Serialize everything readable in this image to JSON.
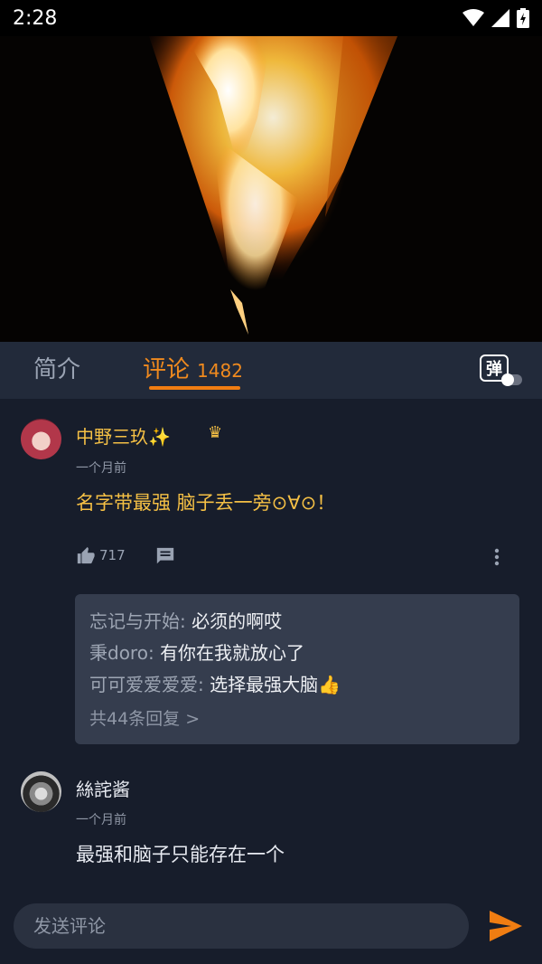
{
  "status_bar": {
    "time": "2:28"
  },
  "tabs": [
    {
      "label": "简介"
    },
    {
      "label": "评论",
      "count": "1482"
    }
  ],
  "danmaku": {
    "label": "弹"
  },
  "comments": [
    {
      "username": "中野三玖✨",
      "time_ago": "一个月前",
      "content": "名字带最强 脑子丢一旁⊙∀⊙！",
      "likes": "717",
      "replies": [
        {
          "user": "忘记与开始",
          "text": "必须的啊哎"
        },
        {
          "user": "秉doro",
          "text": "有你在我就放心了"
        },
        {
          "user": "可可爱爱爱爱",
          "text": "选择最强大脑👍"
        }
      ],
      "more_replies": "共44条回复 >"
    },
    {
      "username": "絲詫酱",
      "time_ago": "一个月前",
      "content": "最强和脑子只能存在一个"
    }
  ],
  "input": {
    "placeholder": "发送评论"
  },
  "colors": {
    "accent": "#f07d12",
    "gold": "#f5c045",
    "background": "#171d2b"
  }
}
